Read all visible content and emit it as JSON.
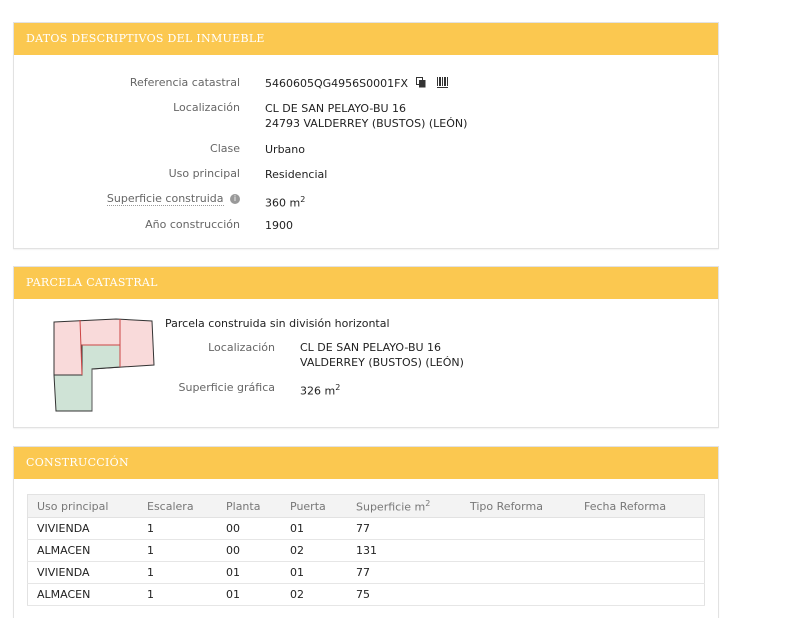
{
  "panel1": {
    "title": "DATOS DESCRIPTIVOS DEL INMUEBLE",
    "ref_label": "Referencia catastral",
    "ref_value": "5460605QG4956S0001FX",
    "loc_label": "Localización",
    "loc_line1": "CL DE SAN PELAYO-BU 16",
    "loc_line2": "24793 VALDERREY (BUSTOS) (LEÓN)",
    "clase_label": "Clase",
    "clase_value": "Urbano",
    "uso_label": "Uso principal",
    "uso_value": "Residencial",
    "sup_label": "Superficie construida",
    "sup_value": "360 m",
    "sup_unit_exp": "2",
    "ano_label": "Año construcción",
    "ano_value": "1900"
  },
  "panel2": {
    "title": "PARCELA CATASTRAL",
    "desc": "Parcela construida sin división horizontal",
    "loc_label": "Localización",
    "loc_line1": "CL DE SAN PELAYO-BU 16",
    "loc_line2": "VALDERREY (BUSTOS) (LEÓN)",
    "sup_label": "Superficie gráfica",
    "sup_value": "326 m",
    "sup_unit_exp": "2"
  },
  "panel3": {
    "title": "CONSTRUCCIÓN",
    "columns": [
      "Uso principal",
      "Escalera",
      "Planta",
      "Puerta",
      "Superficie m",
      "Tipo Reforma",
      "Fecha Reforma"
    ],
    "sup_col_exp": "2",
    "rows": [
      [
        "VIVIENDA",
        "1",
        "00",
        "01",
        "77",
        "",
        ""
      ],
      [
        "ALMACEN",
        "1",
        "00",
        "02",
        "131",
        "",
        ""
      ],
      [
        "VIVIENDA",
        "1",
        "01",
        "01",
        "77",
        "",
        ""
      ],
      [
        "ALMACEN",
        "1",
        "01",
        "02",
        "75",
        "",
        ""
      ]
    ]
  },
  "icons": {
    "copy": "copy-icon",
    "barcode": "barcode-icon",
    "info": "info-icon",
    "info_glyph": "i"
  },
  "colors": {
    "header_bg": "#fbc850",
    "parcel_red": "#f9dada",
    "parcel_green": "#cfe3d6"
  }
}
